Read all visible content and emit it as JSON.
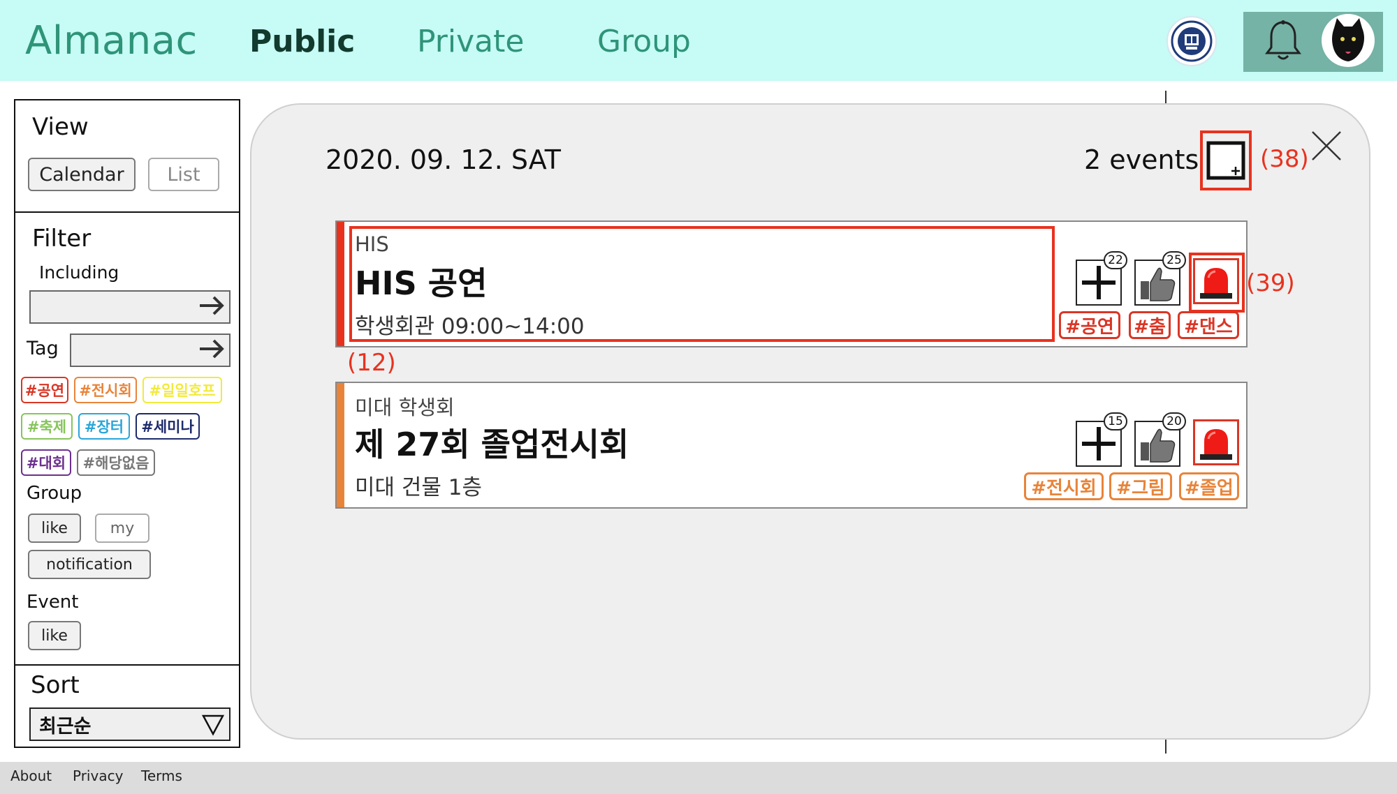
{
  "header": {
    "logo": "Almanac",
    "nav": {
      "public": "Public",
      "private": "Private",
      "group": "Group"
    },
    "icons": {
      "emblem": "university-emblem-icon",
      "bell": "bell-icon",
      "avatar": "black-cat-avatar"
    }
  },
  "sidebar": {
    "view": {
      "title": "View",
      "calendar": "Calendar",
      "list": "List"
    },
    "filter": {
      "title": "Filter",
      "including": "Including",
      "tag_label": "Tag",
      "tags": [
        {
          "label": "#공연",
          "color": "#d93626"
        },
        {
          "label": "#전시회",
          "color": "#e8843a"
        },
        {
          "label": "#일일호프",
          "color": "#f2ea3c"
        },
        {
          "label": "#축제",
          "color": "#86c55a"
        },
        {
          "label": "#장터",
          "color": "#2aa6d8"
        },
        {
          "label": "#세미나",
          "color": "#1c2a6b"
        },
        {
          "label": "#대회",
          "color": "#6d2f8f"
        },
        {
          "label": "#해당없음",
          "color": "#777777"
        }
      ],
      "group_label": "Group",
      "group_like": "like",
      "group_my": "my",
      "group_notification": "notification",
      "event_label": "Event",
      "event_like": "like"
    },
    "sort": {
      "title": "Sort",
      "selected": "최근순"
    }
  },
  "modal": {
    "date": "2020. 09. 12. SAT",
    "count": "2 events",
    "annotations": {
      "add": "(38)",
      "alarm": "(39)",
      "card": "(12)"
    },
    "events": [
      {
        "group": "HIS",
        "title": "HIS 공연",
        "place_time": "학생회관  09:00~14:00",
        "stripe_color": "#e8321e",
        "add_count": "22",
        "like_count": "25",
        "tags": [
          "#공연",
          "#춤",
          "#댄스"
        ],
        "tag_color": "#d93626"
      },
      {
        "group": "미대 학생회",
        "title": "제 27회 졸업전시회",
        "place_time": "미대 건물 1층",
        "stripe_color": "#e8843a",
        "add_count": "15",
        "like_count": "20",
        "tags": [
          "#전시회",
          "#그림",
          "#졸업"
        ],
        "tag_color": "#e8843a"
      }
    ]
  },
  "footer": {
    "about": "About",
    "privacy": "Privacy",
    "terms": "Terms"
  }
}
